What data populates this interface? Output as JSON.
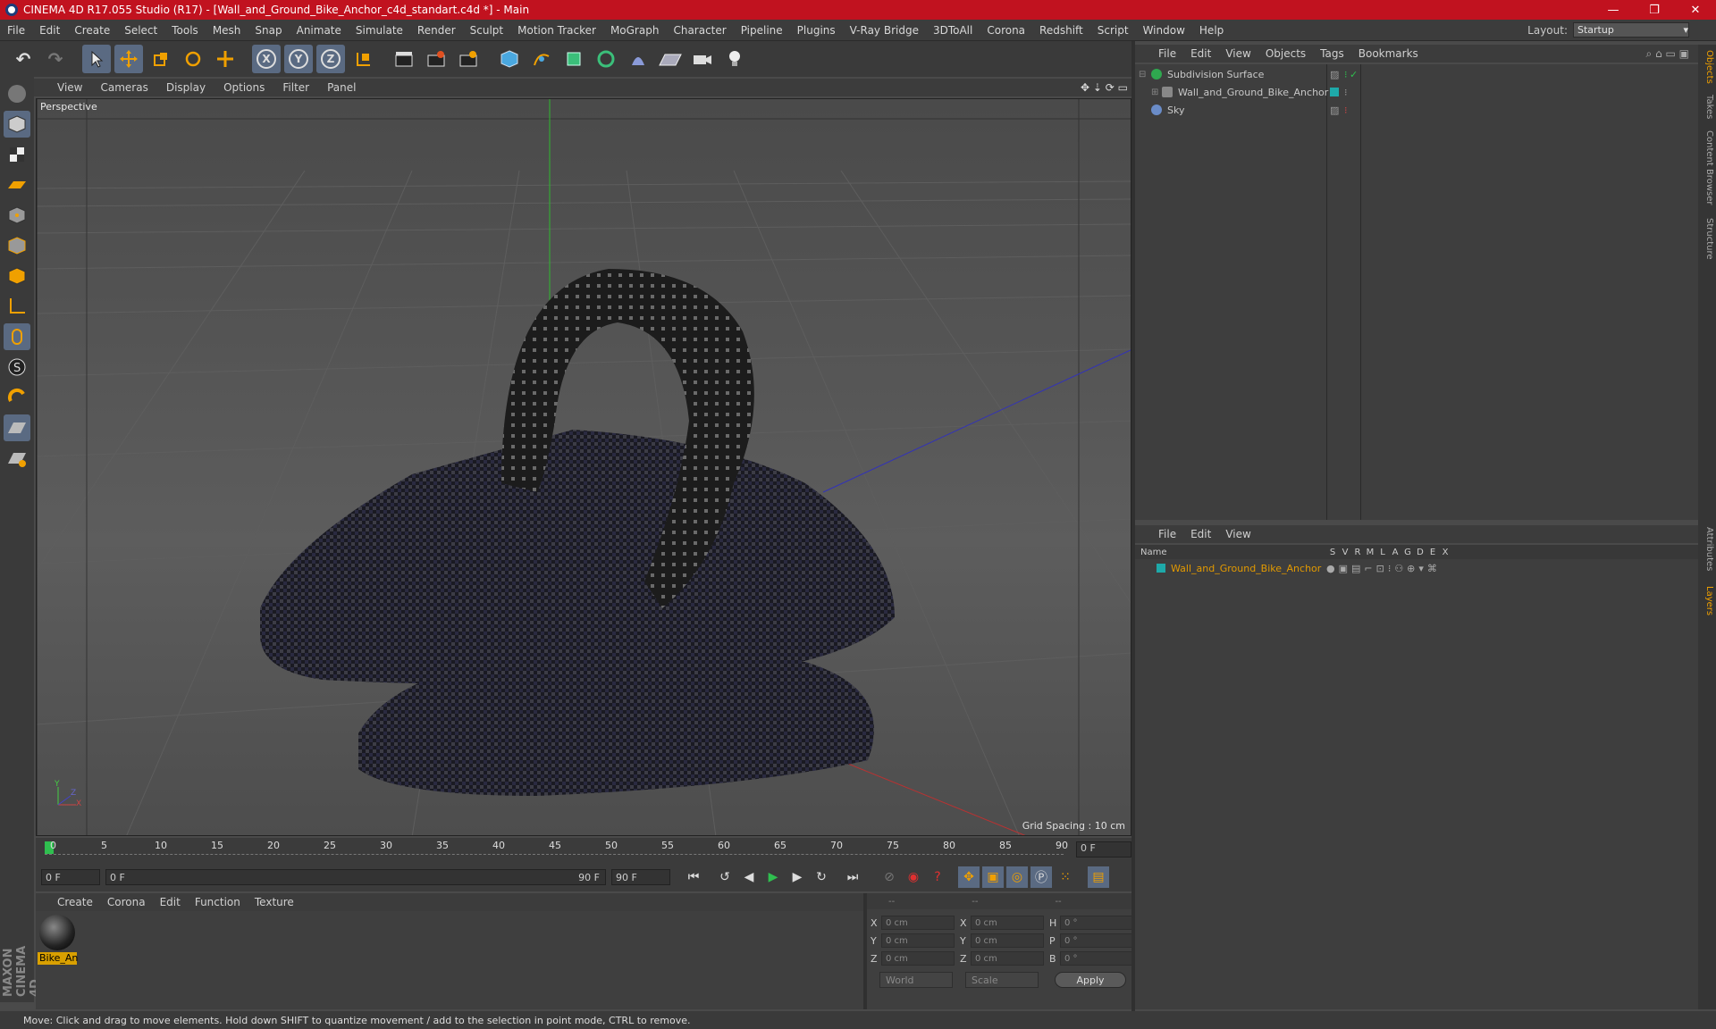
{
  "window": {
    "title": "CINEMA 4D R17.055 Studio (R17) - [Wall_and_Ground_Bike_Anchor_c4d_standart.c4d *] - Main",
    "buttons": [
      "—",
      "❐",
      "✕"
    ]
  },
  "menubar": {
    "items": [
      "File",
      "Edit",
      "Create",
      "Select",
      "Tools",
      "Mesh",
      "Snap",
      "Animate",
      "Simulate",
      "Render",
      "Sculpt",
      "Motion Tracker",
      "MoGraph",
      "Character",
      "Pipeline",
      "Plugins",
      "V-Ray Bridge",
      "3DToAll",
      "Corona",
      "Redshift",
      "Script",
      "Window",
      "Help"
    ],
    "layout_label": "Layout:",
    "layout_value": "Startup"
  },
  "toolbar": {
    "undo": "↶",
    "redo": "↷",
    "axis_x": "X",
    "axis_y": "Y",
    "axis_z": "Z"
  },
  "viewport": {
    "menus": [
      "View",
      "Cameras",
      "Display",
      "Options",
      "Filter",
      "Panel"
    ],
    "label": "Perspective",
    "grid_spacing": "Grid Spacing : 10 cm",
    "axis_x": "X",
    "axis_y": "Y",
    "axis_z": "Z"
  },
  "timeline": {
    "ticks": [
      "0",
      "5",
      "10",
      "15",
      "20",
      "25",
      "30",
      "35",
      "40",
      "45",
      "50",
      "55",
      "60",
      "65",
      "70",
      "75",
      "80",
      "85",
      "90"
    ],
    "frame_field": "0 F",
    "start_field": "0 F",
    "range_start": "0 F",
    "range_end": "90 F",
    "end_field": "90 F"
  },
  "materials": {
    "menus": [
      "Create",
      "Corona",
      "Edit",
      "Function",
      "Texture"
    ],
    "items": [
      {
        "label": "Bike_An"
      }
    ]
  },
  "coordinates": {
    "header": [
      "--",
      "--",
      "--"
    ],
    "rows": [
      {
        "a": "X",
        "av": "0 cm",
        "b": "X",
        "bv": "0 cm",
        "c": "H",
        "cv": "0 °"
      },
      {
        "a": "Y",
        "av": "0 cm",
        "b": "Y",
        "bv": "0 cm",
        "c": "P",
        "cv": "0 °"
      },
      {
        "a": "Z",
        "av": "0 cm",
        "b": "Z",
        "bv": "0 cm",
        "c": "B",
        "cv": "0 °"
      }
    ],
    "mode1": "World",
    "mode2": "Scale",
    "apply": "Apply"
  },
  "status": "Move: Click and drag to move elements. Hold down SHIFT to quantize movement / add to the selection in point mode, CTRL to remove.",
  "objects": {
    "menus": [
      "File",
      "Edit",
      "View",
      "Objects",
      "Tags",
      "Bookmarks"
    ],
    "rows": [
      {
        "name": "Subdivision Surface",
        "color": "#2fa84f"
      },
      {
        "name": "Wall_and_Ground_Bike_Anchor",
        "color": "#888888"
      },
      {
        "name": "Sky",
        "color": "#6a8cc8"
      }
    ]
  },
  "layers": {
    "menus": [
      "File",
      "Edit",
      "View"
    ],
    "columns": [
      "Name",
      "S",
      "V",
      "R",
      "M",
      "L",
      "A",
      "G",
      "D",
      "E",
      "X"
    ],
    "row": "Wall_and_Ground_Bike_Anchor"
  },
  "right_tabs": [
    "Objects",
    "Takes",
    "Content Browser",
    "Structure",
    "Attributes",
    "Layers"
  ],
  "brand": "MAXON CINEMA 4D",
  "colors": {
    "title_bg": "#c1121f",
    "selection": "#e39a00",
    "accent_blue": "#5a6a82"
  }
}
